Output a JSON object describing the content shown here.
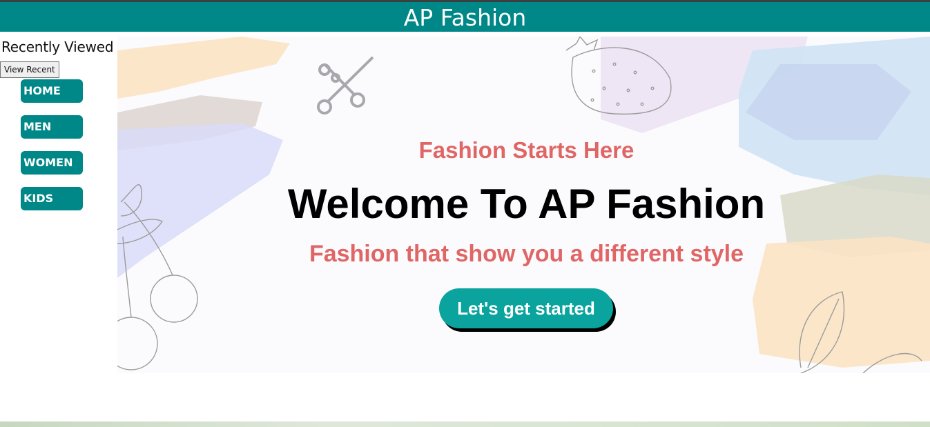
{
  "header": {
    "title": "AP Fashion"
  },
  "sidebar": {
    "recent_title": "Recently Viewed",
    "view_recent_label": "View Recent",
    "items": [
      {
        "label": "HOME"
      },
      {
        "label": "MEN"
      },
      {
        "label": "WOMEN"
      },
      {
        "label": "KIDS"
      }
    ]
  },
  "hero": {
    "tagline_top": "Fashion Starts Here",
    "title": "Welcome To AP Fashion",
    "tagline_bottom": "Fashion that show you a different style",
    "cta_label": "Let's get started"
  },
  "colors": {
    "brand": "#008787",
    "accent_text": "#e06666",
    "cta": "#0aa39d"
  },
  "icons": [
    "scissors-icon",
    "strawberry-icon",
    "cherry-icon",
    "leaf-icon"
  ]
}
